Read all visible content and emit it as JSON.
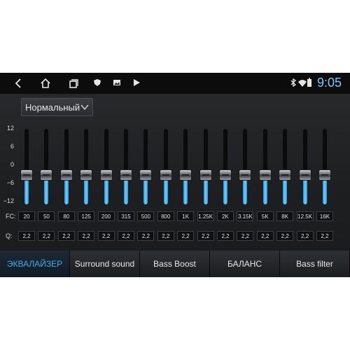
{
  "status": {
    "time": "9:05"
  },
  "equalizer": {
    "preset": "Нормальный",
    "y_ticks": [
      "12",
      "6",
      "0",
      "−6",
      "−12"
    ],
    "fc_label": "FC:",
    "q_label": "Q:",
    "bands": [
      {
        "fc": "20",
        "q": "2,2",
        "level": -3
      },
      {
        "fc": "50",
        "q": "2,2",
        "level": -3
      },
      {
        "fc": "80",
        "q": "2,2",
        "level": -3
      },
      {
        "fc": "125",
        "q": "2,2",
        "level": -3
      },
      {
        "fc": "200",
        "q": "2,2",
        "level": -3
      },
      {
        "fc": "315",
        "q": "2,2",
        "level": -3
      },
      {
        "fc": "500",
        "q": "2,2",
        "level": -3
      },
      {
        "fc": "800",
        "q": "2,2",
        "level": -3
      },
      {
        "fc": "1K",
        "q": "2,2",
        "level": -3
      },
      {
        "fc": "1.25K",
        "q": "2,2",
        "level": -3
      },
      {
        "fc": "2K",
        "q": "2,2",
        "level": -3
      },
      {
        "fc": "3.15K",
        "q": "2,2",
        "level": -3
      },
      {
        "fc": "5K",
        "q": "2,2",
        "level": -3
      },
      {
        "fc": "8K",
        "q": "2,2",
        "level": -3
      },
      {
        "fc": "12.5K",
        "q": "2,2",
        "level": -3
      },
      {
        "fc": "16K",
        "q": "2,2",
        "level": -3
      }
    ],
    "range": [
      -12,
      12
    ]
  },
  "tabs": [
    {
      "label": "ЭКВАЛАЙЗЕР",
      "active": true
    },
    {
      "label": "Surround sound",
      "active": false
    },
    {
      "label": "Bass Boost",
      "active": false
    },
    {
      "label": "БАЛАНС",
      "active": false
    },
    {
      "label": "Bass filter",
      "active": false
    }
  ],
  "colors": {
    "accent": "#4aa8ee",
    "clock": "#7cc8ff",
    "slider_fill": "#6fd0ff"
  },
  "icons": [
    "back-icon",
    "home-icon",
    "recent-apps-icon",
    "shield-icon",
    "gallery-icon",
    "play-store-icon",
    "bluetooth-icon",
    "wifi-icon",
    "battery-icon",
    "chevron-down-icon"
  ]
}
